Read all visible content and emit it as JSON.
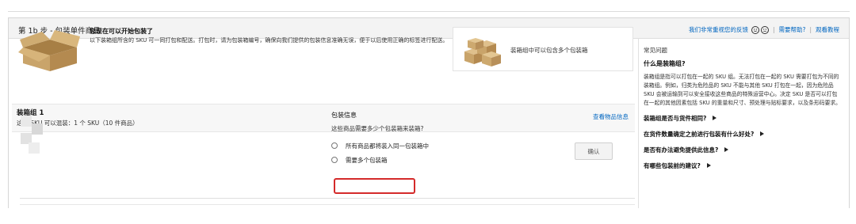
{
  "header": {
    "step_title": "第 1b 步 - 包装单件商品",
    "feedback_link": "我们非常重视您的反馈",
    "need_help": "需要帮助?",
    "watch_tutorial": "观看教程"
  },
  "intro": {
    "title": "您现在可以开始包装了",
    "text": "以下装箱组所含的 SKU 可一同打包和配送。打包时，请为包装箱编号，确保向我们提供的包装信息准确无误，便于以后使用正确的标签进行配送。",
    "multi_box_text": "装箱组中可以包含多个包装箱"
  },
  "group": {
    "title": "装箱组 1",
    "subtitle": "这些 SKU 可以混装：1 个 SKU（10 件商品）",
    "view_info": "查看物品信息"
  },
  "packing": {
    "title": "包装信息",
    "question": "这些商品需要多少个包装箱来装箱?",
    "option1": "所有商品都将装入同一包装箱中",
    "option2": "需要多个包装箱",
    "confirm": "确认"
  },
  "faq": {
    "title": "常见问题",
    "q1": "什么是装箱组?",
    "a1": "装箱组是指可以打包在一起的 SKU 组。无法打包在一起的 SKU 需要打包为不同的装箱组。例如，归类为危险品的 SKU 不能与其他 SKU 打包在一起，因为危险品 SKU 会被运输到可以安全接收这些商品的特殊运营中心。决定 SKU 是否可以打包在一起的其他因素包括 SKU 的重量和尺寸、预处理与贴标要求，以及条形码要求。",
    "q2": "装箱组是否与货件相同?",
    "q3": "在货件数量确定之前进行包装有什么好处?",
    "q4": "是否有办法避免提供此信息?",
    "q5": "有哪些包装前的建议?"
  },
  "colors": {
    "link": "#0066c0",
    "highlight": "#d42a2a",
    "box": "#c9a46a"
  }
}
